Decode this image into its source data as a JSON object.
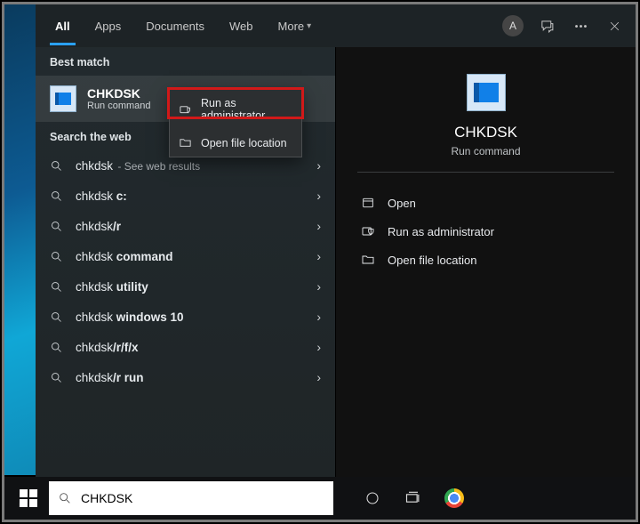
{
  "tabs": {
    "all": "All",
    "apps": "Apps",
    "documents": "Documents",
    "web": "Web",
    "more": "More"
  },
  "top": {
    "avatar": "A"
  },
  "sections": {
    "best_match": "Best match",
    "search_web": "Search the web"
  },
  "best_match": {
    "title": "CHKDSK",
    "subtitle": "Run command"
  },
  "context_menu": {
    "run_admin": "Run as administrator",
    "open_loc": "Open file location"
  },
  "web_results": [
    {
      "prefix": "chkdsk",
      "bold": "",
      "suffix": " - See web results"
    },
    {
      "prefix": "chkdsk ",
      "bold": "c:",
      "suffix": ""
    },
    {
      "prefix": "chkdsk",
      "bold": "/r",
      "suffix": ""
    },
    {
      "prefix": "chkdsk ",
      "bold": "command",
      "suffix": ""
    },
    {
      "prefix": "chkdsk ",
      "bold": "utility",
      "suffix": ""
    },
    {
      "prefix": "chkdsk ",
      "bold": "windows 10",
      "suffix": ""
    },
    {
      "prefix": "chkdsk",
      "bold": "/r/f/x",
      "suffix": ""
    },
    {
      "prefix": "chkdsk",
      "bold": "/r run",
      "suffix": ""
    }
  ],
  "preview": {
    "title": "CHKDSK",
    "subtitle": "Run command",
    "actions": {
      "open": "Open",
      "run_admin": "Run as administrator",
      "open_loc": "Open file location"
    }
  },
  "search": {
    "value": "CHKDSK"
  }
}
